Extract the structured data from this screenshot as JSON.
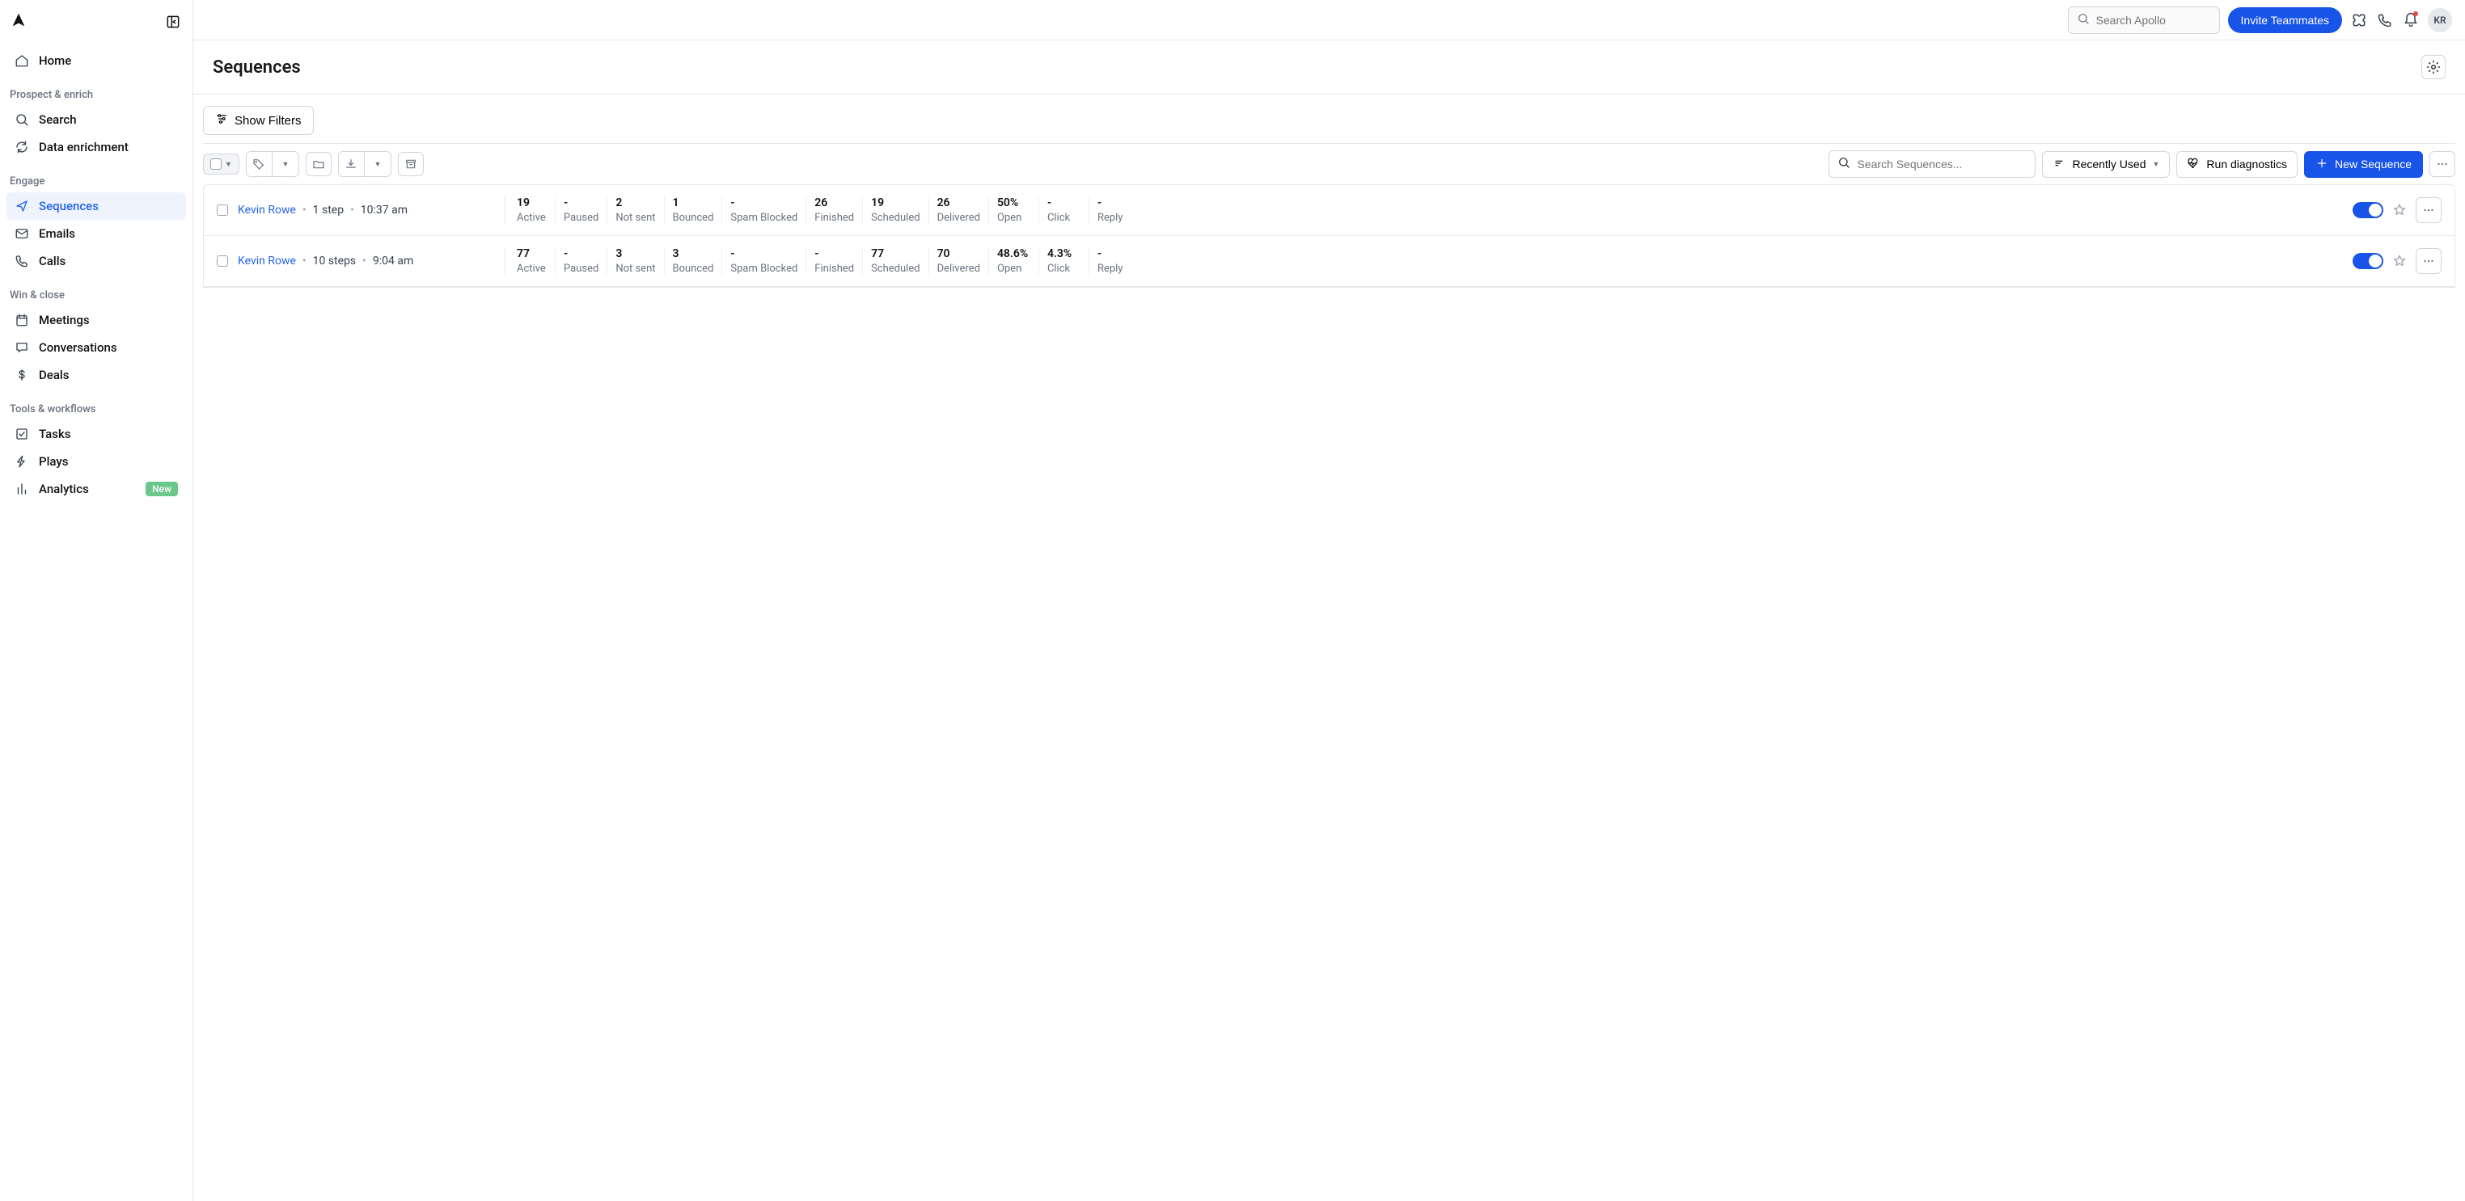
{
  "header": {
    "search_placeholder": "Search Apollo",
    "invite_label": "Invite Teammates",
    "avatar_initials": "KR"
  },
  "sidebar": {
    "home": "Home",
    "sections": [
      {
        "heading": "Prospect & enrich",
        "items": [
          {
            "icon": "search",
            "label": "Search"
          },
          {
            "icon": "refresh",
            "label": "Data enrichment"
          }
        ]
      },
      {
        "heading": "Engage",
        "items": [
          {
            "icon": "send",
            "label": "Sequences",
            "active": true
          },
          {
            "icon": "mail",
            "label": "Emails"
          },
          {
            "icon": "phone",
            "label": "Calls"
          }
        ]
      },
      {
        "heading": "Win & close",
        "items": [
          {
            "icon": "calendar",
            "label": "Meetings"
          },
          {
            "icon": "chat",
            "label": "Conversations"
          },
          {
            "icon": "dollar",
            "label": "Deals"
          }
        ]
      },
      {
        "heading": "Tools & workflows",
        "items": [
          {
            "icon": "check",
            "label": "Tasks"
          },
          {
            "icon": "bolt",
            "label": "Plays"
          },
          {
            "icon": "bars",
            "label": "Analytics",
            "badge": "New"
          }
        ]
      }
    ]
  },
  "page": {
    "title": "Sequences",
    "show_filters": "Show Filters",
    "search_placeholder": "Search Sequences...",
    "sort_label": "Recently Used",
    "diagnostics_label": "Run diagnostics",
    "new_sequence_label": "New Sequence"
  },
  "stat_labels": [
    "Active",
    "Paused",
    "Not sent",
    "Bounced",
    "Spam Blocked",
    "Finished",
    "Scheduled",
    "Delivered",
    "Open",
    "Click",
    "Reply"
  ],
  "rows": [
    {
      "owner": "Kevin Rowe",
      "steps": "1 step",
      "time": "10:37 am",
      "stats": [
        "19",
        "-",
        "2",
        "1",
        "-",
        "26",
        "19",
        "26",
        "50%",
        "-",
        "-"
      ]
    },
    {
      "owner": "Kevin Rowe",
      "steps": "10 steps",
      "time": "9:04 am",
      "stats": [
        "77",
        "-",
        "3",
        "3",
        "-",
        "-",
        "77",
        "70",
        "48.6%",
        "4.3%",
        "-"
      ]
    }
  ]
}
